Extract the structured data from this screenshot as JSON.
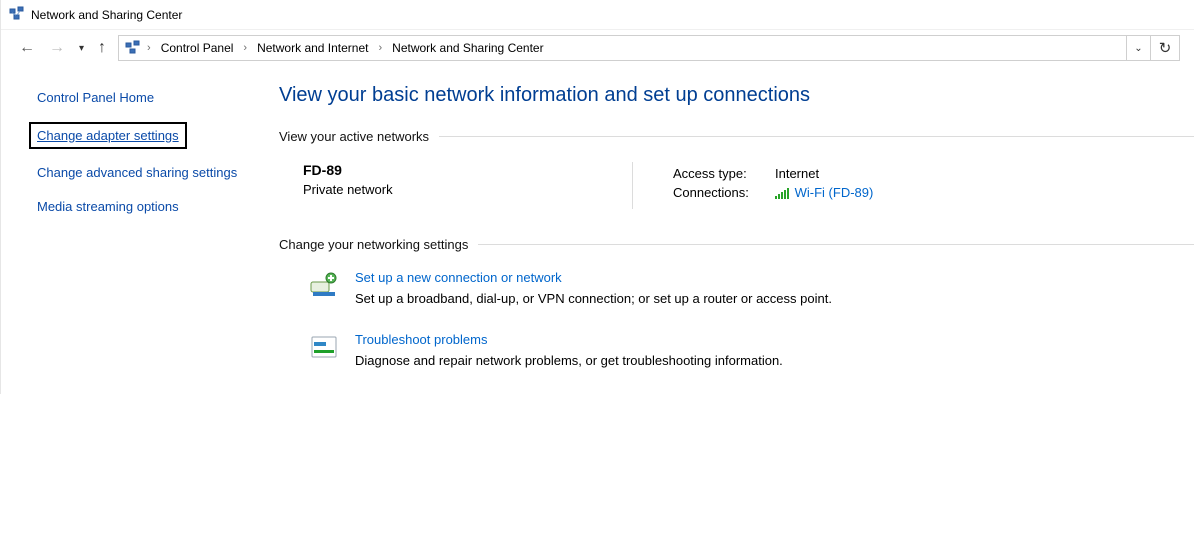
{
  "window": {
    "title": "Network and Sharing Center"
  },
  "breadcrumbs": [
    {
      "label": "Control Panel"
    },
    {
      "label": "Network and Internet"
    },
    {
      "label": "Network and Sharing Center"
    }
  ],
  "sidebar": {
    "items": [
      {
        "label": "Control Panel Home",
        "highlighted": false
      },
      {
        "label": "Change adapter settings",
        "highlighted": true
      },
      {
        "label": "Change advanced sharing settings",
        "highlighted": false
      },
      {
        "label": "Media streaming options",
        "highlighted": false
      }
    ]
  },
  "main": {
    "title": "View your basic network information and set up connections",
    "active_networks_label": "View your active networks",
    "network": {
      "name": "FD-89",
      "type": "Private network",
      "access_type_label": "Access type:",
      "access_type_value": "Internet",
      "connections_label": "Connections:",
      "connection_link": "Wi-Fi (FD-89)"
    },
    "change_settings_label": "Change your networking settings",
    "options": [
      {
        "link": "Set up a new connection or network",
        "desc": "Set up a broadband, dial-up, or VPN connection; or set up a router or access point."
      },
      {
        "link": "Troubleshoot problems",
        "desc": "Diagnose and repair network problems, or get troubleshooting information."
      }
    ]
  }
}
